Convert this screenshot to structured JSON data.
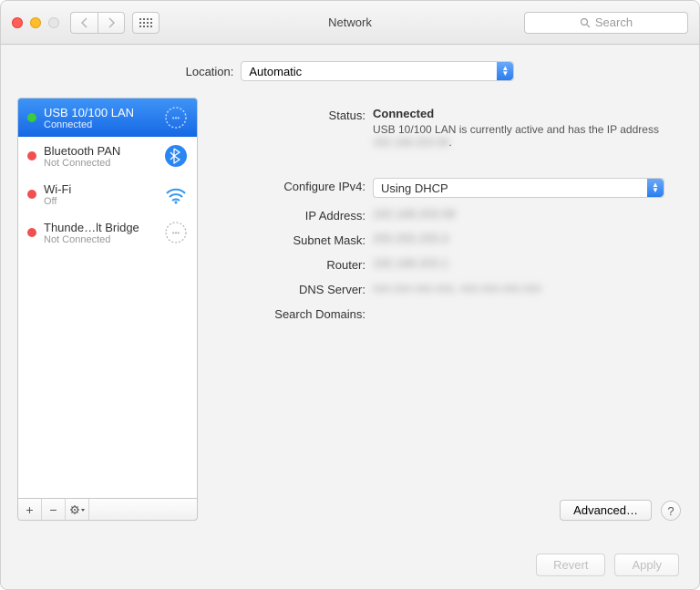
{
  "header": {
    "title": "Network",
    "search_placeholder": "Search"
  },
  "location": {
    "label": "Location:",
    "value": "Automatic"
  },
  "sidebar": {
    "services": [
      {
        "name": "USB 10/100 LAN",
        "status": "Connected",
        "dot": "green",
        "icon": "ethernet-icon"
      },
      {
        "name": "Bluetooth PAN",
        "status": "Not Connected",
        "dot": "red",
        "icon": "bluetooth-icon"
      },
      {
        "name": "Wi-Fi",
        "status": "Off",
        "dot": "red",
        "icon": "wifi-icon"
      },
      {
        "name": "Thunde…lt Bridge",
        "status": "Not Connected",
        "dot": "red",
        "icon": "thunderbolt-bridge-icon"
      }
    ],
    "footer_buttons": {
      "add": "+",
      "remove": "−",
      "action": "gear"
    }
  },
  "detail": {
    "status": {
      "label": "Status:",
      "value": "Connected",
      "description_pre": "USB 10/100 LAN is currently active and has the IP address",
      "description_ip": "192.168.203.58",
      "description_post": "."
    },
    "configure_ipv4": {
      "label": "Configure IPv4:",
      "value": "Using DHCP"
    },
    "ip_address": {
      "label": "IP Address:",
      "value": "192.168.203.58"
    },
    "subnet_mask": {
      "label": "Subnet Mask:",
      "value": "255.255.255.0"
    },
    "router": {
      "label": "Router:",
      "value": "192.168.203.1"
    },
    "dns_server": {
      "label": "DNS Server:",
      "value": "xxx.xxx.xxx.xxx, xxx.xxx.xxx.xxx"
    },
    "search_domains": {
      "label": "Search Domains:",
      "value": " "
    },
    "advanced_label": "Advanced…",
    "help_label": "?"
  },
  "footer": {
    "revert": "Revert",
    "apply": "Apply"
  }
}
